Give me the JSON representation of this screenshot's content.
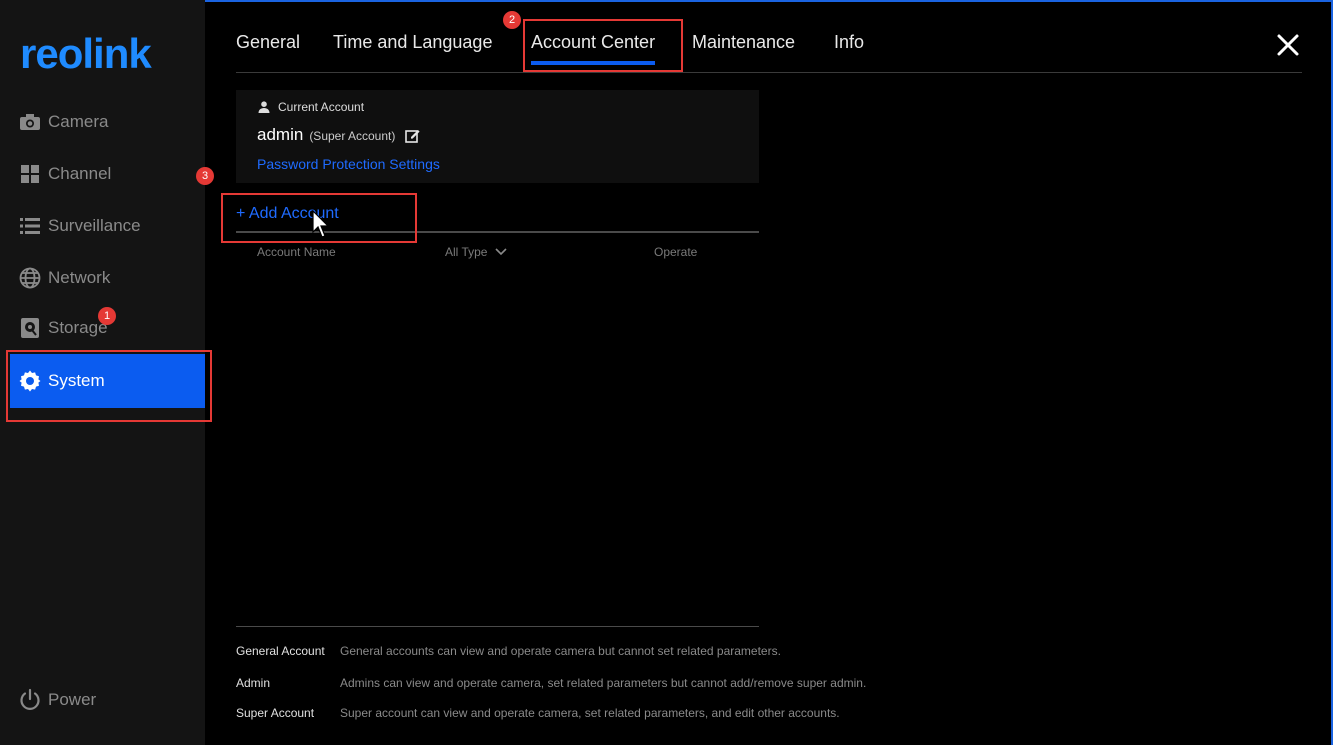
{
  "brand": {
    "logo_text": "reolink",
    "accent": "#0b5cf0",
    "link_color": "#1f6bff"
  },
  "sidebar": {
    "items": [
      {
        "label": "Camera",
        "icon": "camera-icon"
      },
      {
        "label": "Channel",
        "icon": "grid-icon"
      },
      {
        "label": "Surveillance",
        "icon": "list-icon"
      },
      {
        "label": "Network",
        "icon": "globe-icon"
      },
      {
        "label": "Storage",
        "icon": "storage-icon"
      },
      {
        "label": "System",
        "icon": "gear-icon",
        "active": true
      }
    ],
    "power_label": "Power"
  },
  "tabs": [
    {
      "label": "General"
    },
    {
      "label": "Time and Language"
    },
    {
      "label": "Account Center",
      "active": true
    },
    {
      "label": "Maintenance"
    },
    {
      "label": "Info"
    }
  ],
  "current_account": {
    "heading": "Current Account",
    "name": "admin",
    "role": "(Super Account)",
    "password_link": "Password Protection Settings"
  },
  "add_account_label": "+ Add Account",
  "table": {
    "columns": {
      "name": "Account Name",
      "type": "All Type",
      "operate": "Operate"
    }
  },
  "legend": [
    {
      "term": "General Account",
      "desc": "General accounts can view and operate camera but cannot set related parameters."
    },
    {
      "term": "Admin",
      "desc": "Admins can view and operate camera, set related parameters but cannot add/remove super admin."
    },
    {
      "term": "Super Account",
      "desc": "Super account can view and operate camera, set related parameters, and edit other accounts."
    }
  ],
  "annotations": {
    "step1": "1",
    "step2": "2",
    "step3": "3",
    "highlight_color": "#e53935"
  }
}
